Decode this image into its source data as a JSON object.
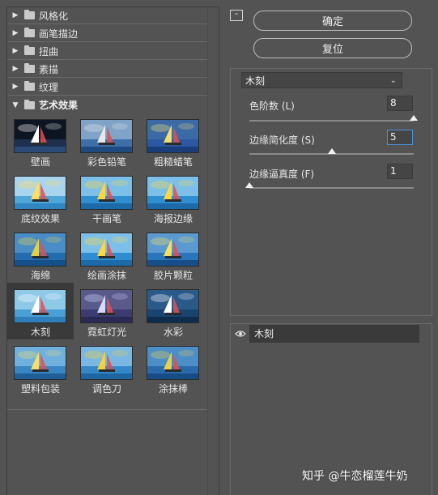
{
  "categories": [
    {
      "label": "风格化",
      "expanded": false
    },
    {
      "label": "画笔描边",
      "expanded": false
    },
    {
      "label": "扭曲",
      "expanded": false
    },
    {
      "label": "素描",
      "expanded": false
    },
    {
      "label": "纹理",
      "expanded": false
    },
    {
      "label": "艺术效果",
      "expanded": true
    }
  ],
  "thumbnails": [
    {
      "label": "壁画",
      "style": "dark"
    },
    {
      "label": "彩色铅笔",
      "style": "sketch"
    },
    {
      "label": "粗糙蜡笔",
      "style": "rough"
    },
    {
      "label": "底纹效果",
      "style": "light"
    },
    {
      "label": "干画笔",
      "style": "normal"
    },
    {
      "label": "海报边缘",
      "style": "normal"
    },
    {
      "label": "海绵",
      "style": "sponge"
    },
    {
      "label": "绘画涂抹",
      "style": "normal"
    },
    {
      "label": "胶片颗粒",
      "style": "grain"
    },
    {
      "label": "木刻",
      "style": "woodcut"
    },
    {
      "label": "霓虹灯光",
      "style": "neon"
    },
    {
      "label": "水彩",
      "style": "water"
    },
    {
      "label": "塑料包装",
      "style": "plastic"
    },
    {
      "label": "调色刀",
      "style": "knife"
    },
    {
      "label": "涂抹棒",
      "style": "smudge"
    }
  ],
  "selected_thumbnail": "木刻",
  "buttons": {
    "ok": "确定",
    "reset": "复位"
  },
  "filter_select": {
    "value": "木刻"
  },
  "params": [
    {
      "label": "色阶数 (L)",
      "value": "8",
      "level": 1.0
    },
    {
      "label": "边缘简化度 (S)",
      "value": "5",
      "level": 0.5
    },
    {
      "label": "边缘逼真度 (F)",
      "value": "1",
      "level": 0.0
    }
  ],
  "layers": [
    {
      "name": "木刻",
      "visible": true
    }
  ],
  "watermark": "知乎 @牛恋榴莲牛奶",
  "colors": {
    "panel_bg": "#535353",
    "selected_bg": "#3a3a3a",
    "focus": "#4e8fd6"
  }
}
